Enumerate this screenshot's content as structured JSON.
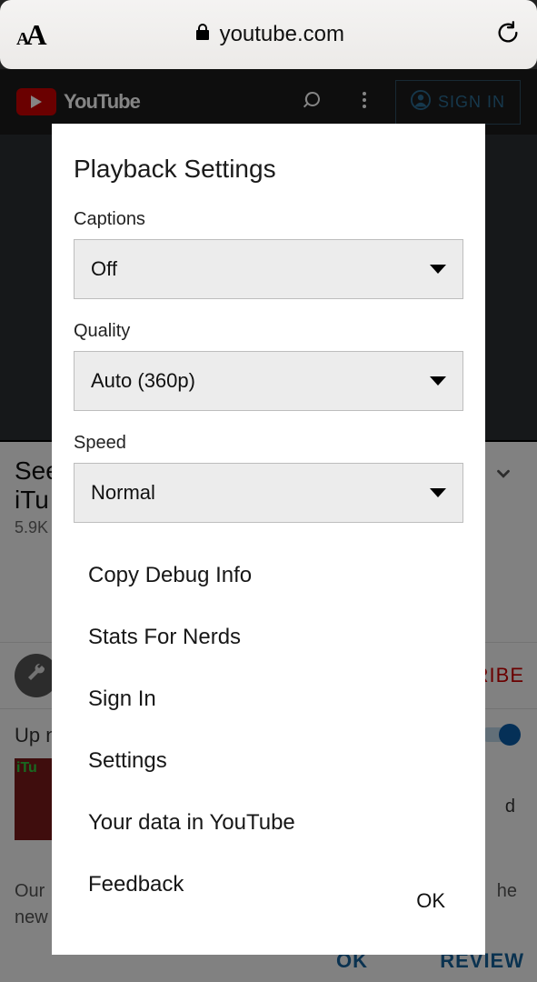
{
  "urlbar": {
    "address": "youtube.com"
  },
  "yt_header": {
    "brand": "YouTube",
    "sign_in": "SIGN IN"
  },
  "background": {
    "video_title_line1": "See",
    "video_title_line2": "iTu",
    "views": "5.9K",
    "subscribe_fragment": "RIBE",
    "up_next": "Up n",
    "queue_thumb_text": "iTu",
    "queue_title_fragment": "d",
    "footer_line1": "Our",
    "footer_line2": "new",
    "footer_right_fragment": "he",
    "cookie_ok": "OK",
    "cookie_review": "REVIEW"
  },
  "modal": {
    "title": "Playback Settings",
    "captions": {
      "label": "Captions",
      "value": "Off"
    },
    "quality": {
      "label": "Quality",
      "value": "Auto (360p)"
    },
    "speed": {
      "label": "Speed",
      "value": "Normal"
    },
    "menu": {
      "copy_debug": "Copy Debug Info",
      "stats": "Stats For Nerds",
      "sign_in": "Sign In",
      "settings": "Settings",
      "your_data": "Your data in YouTube",
      "feedback": "Feedback"
    },
    "ok": "OK"
  }
}
